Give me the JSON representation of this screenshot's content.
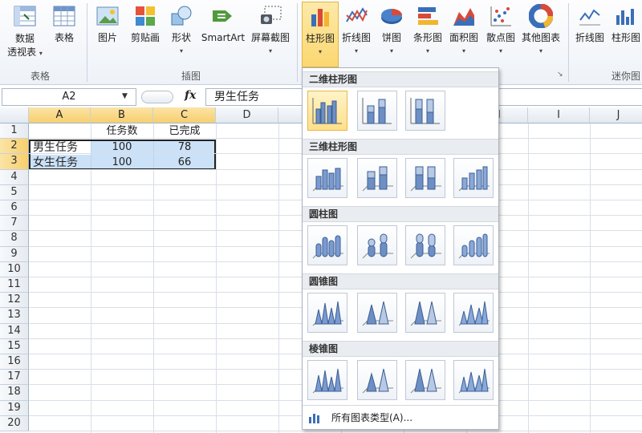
{
  "ribbon": {
    "buttons": [
      {
        "id": "pivot",
        "label": "数据\n透视表",
        "caret": "▾"
      },
      {
        "id": "table",
        "label": "表格"
      },
      {
        "id": "picture",
        "label": "图片"
      },
      {
        "id": "clipart",
        "label": "剪贴画"
      },
      {
        "id": "shapes",
        "label": "形状",
        "caret": "▾"
      },
      {
        "id": "smartart",
        "label": "SmartArt"
      },
      {
        "id": "screenshot",
        "label": "屏幕截图",
        "caret": "▾"
      },
      {
        "id": "column",
        "label": "柱形图",
        "caret": "▾"
      },
      {
        "id": "line",
        "label": "折线图",
        "caret": "▾"
      },
      {
        "id": "pie",
        "label": "饼图",
        "caret": "▾"
      },
      {
        "id": "bar",
        "label": "条形图",
        "caret": "▾"
      },
      {
        "id": "area",
        "label": "面积图",
        "caret": "▾"
      },
      {
        "id": "scatter",
        "label": "散点图",
        "caret": "▾"
      },
      {
        "id": "other",
        "label": "其他图表",
        "caret": "▾"
      },
      {
        "id": "spark-line",
        "label": "折线图"
      },
      {
        "id": "spark-column",
        "label": "柱形图"
      }
    ],
    "groups": {
      "tables": "表格",
      "illustrations": "插图",
      "sparklines": "迷你图"
    },
    "dialog_launcher": "↘"
  },
  "formula_bar": {
    "name_box": "A2",
    "fx": "fx",
    "formula": "男生任务"
  },
  "sheet": {
    "columns": [
      "A",
      "B",
      "C",
      "D",
      "E",
      "F",
      "G",
      "H",
      "I",
      "J"
    ],
    "rows": [
      "1",
      "2",
      "3",
      "4",
      "5",
      "6",
      "7",
      "8",
      "9",
      "10",
      "11",
      "12",
      "13",
      "14",
      "15",
      "16",
      "17",
      "18",
      "19",
      "20"
    ],
    "cells": {
      "B1": "任务数",
      "C1": "已完成",
      "A2": "男生任务",
      "B2": "100",
      "C2": "78",
      "A3": "女生任务",
      "B3": "100",
      "C3": "66"
    }
  },
  "dropdown": {
    "sections": [
      "二维柱形图",
      "三维柱形图",
      "圆柱图",
      "圆锥图",
      "棱锥图"
    ],
    "all_types": "所有图表类型(A)..."
  }
}
